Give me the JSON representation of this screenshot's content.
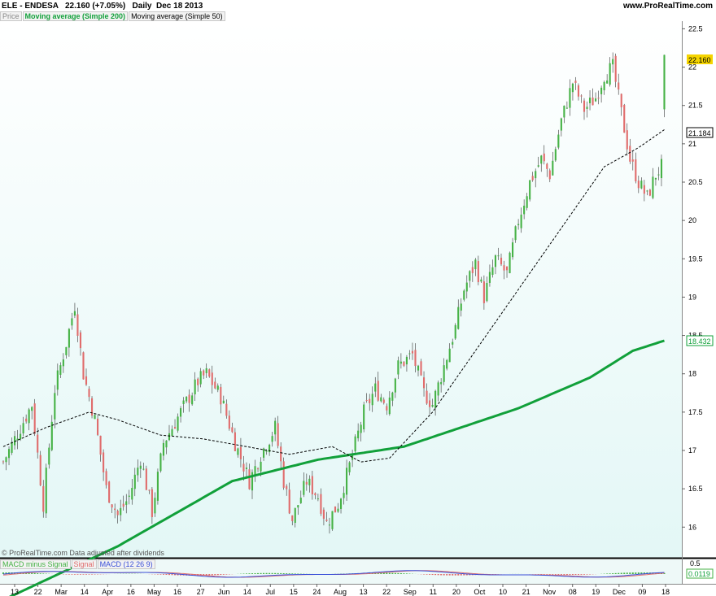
{
  "header": {
    "symbol": "ELE - ENDESA",
    "price_change": "22.160 (+7.05%)",
    "period": "Daily",
    "date": "Dec 18 2013",
    "site": "www.ProRealTime.com"
  },
  "legend": {
    "price": "Price",
    "ma200": "Moving average (Simple 200)",
    "ma50": "Moving average (Simple 50)"
  },
  "macd_legend": {
    "hist": "MACD minus Signal",
    "signal": "Signal",
    "macd": "MACD (12 26 9)"
  },
  "credit": "© ProRealTime.com Data adjusted after dividends",
  "price_labels": {
    "last": "22.160",
    "ma50": "21.184",
    "ma200": "18.432",
    "macd_top": "0.5",
    "macd_val": "0.0119"
  },
  "colors": {
    "background_top": "#ffffff",
    "background_bottom": "#e3f7f6",
    "up": "#46b246",
    "down": "#e06c6c",
    "ma200": "#11a03a",
    "ma50": "#000000",
    "last_badge": "#f5d400",
    "macd_line": "#3a4fd8",
    "signal_line": "#e06c6c"
  },
  "chart_data": {
    "type": "candlestick",
    "y_axis": {
      "min": 15.6,
      "max": 22.6,
      "ticks": [
        "22.5",
        "22",
        "21.5",
        "21",
        "20.5",
        "20",
        "19.5",
        "19",
        "18.5",
        "18",
        "17.5",
        "17",
        "16.5",
        "16"
      ]
    },
    "x_labels": [
      "13",
      "22",
      "Mar",
      "14",
      "Apr",
      "16",
      "May",
      "16",
      "27",
      "Jun",
      "14",
      "Jul",
      "15",
      "24",
      "Aug",
      "13",
      "22",
      "Sep",
      "11",
      "20",
      "Oct",
      "10",
      "21",
      "Nov",
      "08",
      "19",
      "Dec",
      "09",
      "18"
    ],
    "bars": 232,
    "anchors": [
      {
        "i": 0,
        "c": 16.85
      },
      {
        "i": 6,
        "c": 17.3
      },
      {
        "i": 10,
        "c": 17.6
      },
      {
        "i": 14,
        "c": 16.3
      },
      {
        "i": 18,
        "c": 17.8
      },
      {
        "i": 22,
        "c": 18.4
      },
      {
        "i": 25,
        "c": 18.9
      },
      {
        "i": 28,
        "c": 18.0
      },
      {
        "i": 32,
        "c": 17.4
      },
      {
        "i": 36,
        "c": 16.5
      },
      {
        "i": 40,
        "c": 16.15
      },
      {
        "i": 44,
        "c": 16.4
      },
      {
        "i": 48,
        "c": 16.9
      },
      {
        "i": 52,
        "c": 16.2
      },
      {
        "i": 56,
        "c": 17.1
      },
      {
        "i": 62,
        "c": 17.5
      },
      {
        "i": 68,
        "c": 17.9
      },
      {
        "i": 71,
        "c": 18.0
      },
      {
        "i": 76,
        "c": 17.7
      },
      {
        "i": 81,
        "c": 17.1
      },
      {
        "i": 86,
        "c": 16.6
      },
      {
        "i": 90,
        "c": 16.95
      },
      {
        "i": 95,
        "c": 17.3
      },
      {
        "i": 98,
        "c": 16.6
      },
      {
        "i": 101,
        "c": 16.1
      },
      {
        "i": 106,
        "c": 16.6
      },
      {
        "i": 110,
        "c": 16.4
      },
      {
        "i": 113,
        "c": 16.05
      },
      {
        "i": 117,
        "c": 16.3
      },
      {
        "i": 121,
        "c": 16.8
      },
      {
        "i": 126,
        "c": 17.5
      },
      {
        "i": 130,
        "c": 17.8
      },
      {
        "i": 134,
        "c": 17.6
      },
      {
        "i": 138,
        "c": 18.1
      },
      {
        "i": 143,
        "c": 18.25
      },
      {
        "i": 147,
        "c": 17.75
      },
      {
        "i": 150,
        "c": 17.6
      },
      {
        "i": 154,
        "c": 18.1
      },
      {
        "i": 158,
        "c": 18.6
      },
      {
        "i": 161,
        "c": 19.1
      },
      {
        "i": 165,
        "c": 19.45
      },
      {
        "i": 168,
        "c": 19.0
      },
      {
        "i": 172,
        "c": 19.5
      },
      {
        "i": 176,
        "c": 19.3
      },
      {
        "i": 180,
        "c": 20.0
      },
      {
        "i": 184,
        "c": 20.5
      },
      {
        "i": 188,
        "c": 20.8
      },
      {
        "i": 191,
        "c": 20.6
      },
      {
        "i": 195,
        "c": 21.3
      },
      {
        "i": 199,
        "c": 21.8
      },
      {
        "i": 203,
        "c": 21.45
      },
      {
        "i": 207,
        "c": 21.6
      },
      {
        "i": 210,
        "c": 21.9
      },
      {
        "i": 213,
        "c": 22.0
      },
      {
        "i": 216,
        "c": 21.4
      },
      {
        "i": 219,
        "c": 20.8
      },
      {
        "i": 222,
        "c": 20.5
      },
      {
        "i": 225,
        "c": 20.3
      },
      {
        "i": 228,
        "c": 20.6
      },
      {
        "i": 230,
        "c": 20.7
      },
      {
        "i": 231,
        "c": 22.16
      }
    ],
    "ma200": [
      {
        "i": 0,
        "v": 15.05
      },
      {
        "i": 40,
        "v": 15.75
      },
      {
        "i": 80,
        "v": 16.6
      },
      {
        "i": 110,
        "v": 16.88
      },
      {
        "i": 140,
        "v": 17.05
      },
      {
        "i": 160,
        "v": 17.3
      },
      {
        "i": 180,
        "v": 17.55
      },
      {
        "i": 205,
        "v": 17.95
      },
      {
        "i": 220,
        "v": 18.3
      },
      {
        "i": 231,
        "v": 18.432
      }
    ],
    "ma50": [
      {
        "i": 0,
        "v": 17.05
      },
      {
        "i": 15,
        "v": 17.3
      },
      {
        "i": 30,
        "v": 17.5
      },
      {
        "i": 40,
        "v": 17.4
      },
      {
        "i": 55,
        "v": 17.2
      },
      {
        "i": 70,
        "v": 17.15
      },
      {
        "i": 85,
        "v": 17.05
      },
      {
        "i": 100,
        "v": 16.95
      },
      {
        "i": 115,
        "v": 17.05
      },
      {
        "i": 125,
        "v": 16.85
      },
      {
        "i": 135,
        "v": 16.9
      },
      {
        "i": 150,
        "v": 17.5
      },
      {
        "i": 165,
        "v": 18.3
      },
      {
        "i": 180,
        "v": 19.1
      },
      {
        "i": 195,
        "v": 19.9
      },
      {
        "i": 210,
        "v": 20.7
      },
      {
        "i": 222,
        "v": 20.95
      },
      {
        "i": 231,
        "v": 21.184
      }
    ]
  }
}
